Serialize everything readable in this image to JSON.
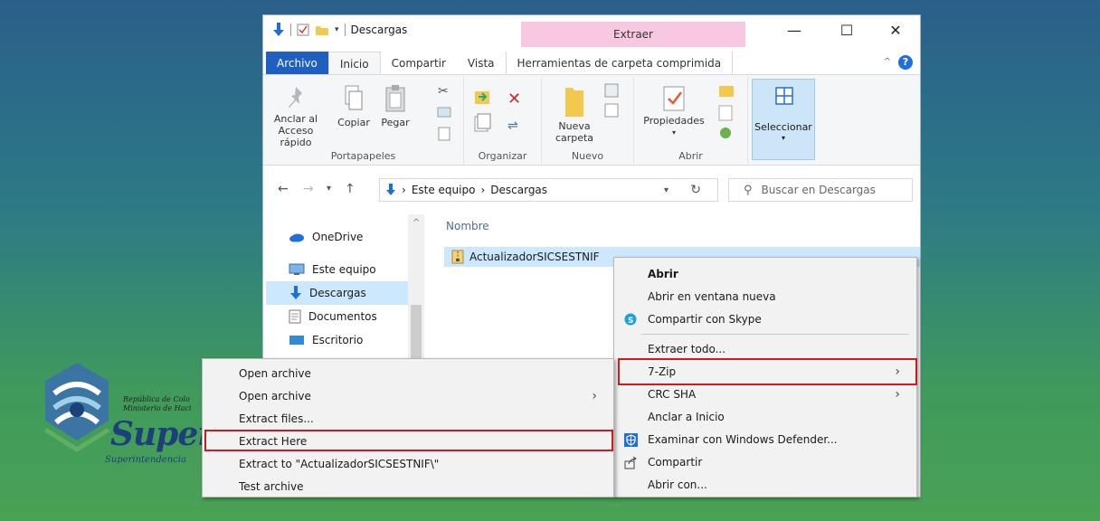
{
  "background_logo": {
    "country_line1": "República de Colo",
    "country_line2": "Ministerio de Haci",
    "brand": "Super",
    "tagline": "Superintendencia"
  },
  "window": {
    "title": "Descargas",
    "context_tab_title": "Extraer",
    "controls": {
      "minimize": "—",
      "maximize": "☐",
      "close": "✕"
    },
    "tabs": [
      "Archivo",
      "Inicio",
      "Compartir",
      "Vista",
      "Herramientas de carpeta comprimida"
    ],
    "help": "?"
  },
  "ribbon": {
    "portapapeles": {
      "label": "Portapapeles",
      "anclar": "Anclar al Acceso rápido",
      "copiar": "Copiar",
      "pegar": "Pegar"
    },
    "organizar": {
      "label": "Organizar"
    },
    "nuevo": {
      "label": "Nuevo",
      "nueva_carpeta": "Nueva carpeta"
    },
    "abrir": {
      "label": "Abrir",
      "propiedades": "Propiedades"
    },
    "seleccionar": {
      "label": "Seleccionar"
    }
  },
  "address": {
    "crumbs": [
      "Este equipo",
      "Descargas"
    ],
    "search_placeholder": "Buscar en Descargas"
  },
  "nav": {
    "items": [
      "OneDrive",
      "Este equipo",
      "Descargas",
      "Documentos",
      "Escritorio"
    ]
  },
  "files": {
    "column_name": "Nombre",
    "rows": [
      "ActualizadorSICSESTNIF"
    ]
  },
  "context_menu": {
    "items": [
      "Abrir",
      "Abrir en ventana nueva",
      "Compartir con Skype",
      "Extraer todo...",
      "7-Zip",
      "CRC SHA",
      "Anclar a Inicio",
      "Examinar con Windows Defender...",
      "Compartir",
      "Abrir con..."
    ]
  },
  "submenu_7zip": {
    "items": [
      "Open archive",
      "Open archive",
      "Extract files...",
      "Extract Here",
      "Extract to \"ActualizadorSICSESTNIF\\\"",
      "Test archive"
    ]
  },
  "colors": {
    "highlight_box": "#d21a1a",
    "file_tab": "#1e5fbf",
    "context_tab": "#f8c8e0",
    "selection": "#cce8ff"
  }
}
